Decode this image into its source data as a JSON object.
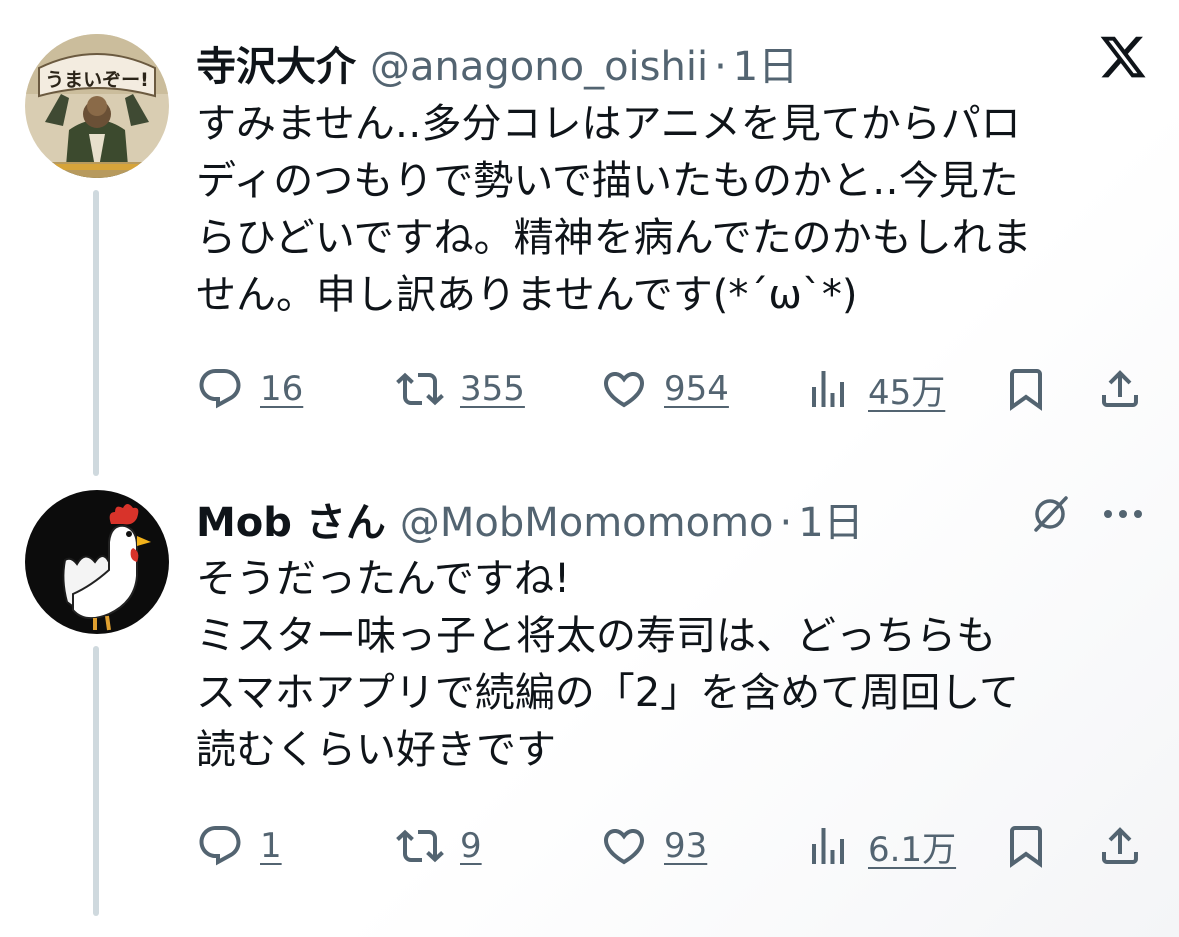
{
  "tweets": [
    {
      "author": {
        "name": "寺沢大介",
        "handle": "@anagono_oishii",
        "avatar_sign": "うまいぞー!"
      },
      "separator": "·",
      "time": "1日",
      "text": "すみません‥多分コレはアニメを見てからパロ\nディのつもりで勢いで描いたものかと‥今見た\nらひどいですね。精神を病んでたのかもしれま\nせん。申し訳ありませんです(*´ω`*)",
      "actions": {
        "reply_count": "16",
        "retweet_count": "355",
        "like_count": "954",
        "view_count": "45万"
      },
      "top_icon": "x-logo-icon"
    },
    {
      "author": {
        "name": "Mob さん",
        "handle": "@MobMomomomo"
      },
      "separator": "·",
      "time": "1日",
      "text": "そうだったんですね!\nミスター味っ子と将太の寿司は、どっちらも\nスマホアプリで続編の「2」を含めて周回して\n読むくらい好きです",
      "actions": {
        "reply_count": "1",
        "retweet_count": "9",
        "like_count": "93",
        "view_count": "6.1万"
      },
      "top_icons": [
        "grok-icon",
        "more-icon"
      ]
    }
  ],
  "colors": {
    "text": "#0f1419",
    "secondary": "#536471",
    "thread_line": "#cfd9de",
    "background": "#ffffff"
  }
}
